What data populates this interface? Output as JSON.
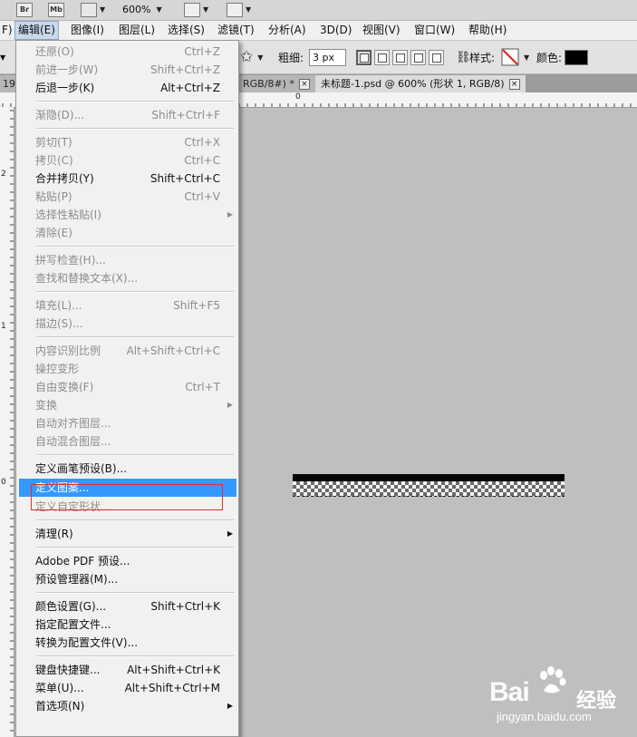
{
  "appbar": {
    "bridge_label": "Br",
    "minibridge_label": "Mb",
    "zoom": "600%"
  },
  "menubar": {
    "items": [
      "F)",
      "编辑(E)",
      "图像(I)",
      "图层(L)",
      "选择(S)",
      "滤镜(T)",
      "分析(A)",
      "3D(D)",
      "视图(V)",
      "窗口(W)",
      "帮助(H)"
    ]
  },
  "options": {
    "weight_label": "粗细:",
    "weight_value": "3 px",
    "style_label": "样式:",
    "color_label": "颜色:",
    "color_value": "#000000"
  },
  "tabs": {
    "left_fragment": "19",
    "doc1": "RGB/8#) *",
    "doc2": "未标题-1.psd @ 600% (形状 1, RGB/8)",
    "close_glyph": "×"
  },
  "rulers": {
    "h_zero": "0",
    "v_labels": [
      "2",
      "1",
      "0"
    ]
  },
  "menu": {
    "items": [
      {
        "label": "还原(O)",
        "shortcut": "Ctrl+Z",
        "enabled": false
      },
      {
        "label": "前进一步(W)",
        "shortcut": "Shift+Ctrl+Z",
        "enabled": false
      },
      {
        "label": "后退一步(K)",
        "shortcut": "Alt+Ctrl+Z",
        "enabled": true
      },
      {
        "label": "渐隐(D)...",
        "shortcut": "Shift+Ctrl+F",
        "enabled": false
      },
      {
        "label": "剪切(T)",
        "shortcut": "Ctrl+X",
        "enabled": false
      },
      {
        "label": "拷贝(C)",
        "shortcut": "Ctrl+C",
        "enabled": false
      },
      {
        "label": "合并拷贝(Y)",
        "shortcut": "Shift+Ctrl+C",
        "enabled": true
      },
      {
        "label": "粘贴(P)",
        "shortcut": "Ctrl+V",
        "enabled": false
      },
      {
        "label": "选择性粘贴(I)",
        "shortcut": "",
        "enabled": false,
        "submenu": true
      },
      {
        "label": "清除(E)",
        "shortcut": "",
        "enabled": false
      },
      {
        "label": "拼写检查(H)...",
        "shortcut": "",
        "enabled": false
      },
      {
        "label": "查找和替换文本(X)...",
        "shortcut": "",
        "enabled": false
      },
      {
        "label": "填充(L)...",
        "shortcut": "Shift+F5",
        "enabled": false
      },
      {
        "label": "描边(S)...",
        "shortcut": "",
        "enabled": false
      },
      {
        "label": "内容识别比例",
        "shortcut": "Alt+Shift+Ctrl+C",
        "enabled": false
      },
      {
        "label": "操控变形",
        "shortcut": "",
        "enabled": false
      },
      {
        "label": "自由变换(F)",
        "shortcut": "Ctrl+T",
        "enabled": false
      },
      {
        "label": "变换",
        "shortcut": "",
        "enabled": false,
        "submenu": true
      },
      {
        "label": "自动对齐图层...",
        "shortcut": "",
        "enabled": false
      },
      {
        "label": "自动混合图层...",
        "shortcut": "",
        "enabled": false
      },
      {
        "label": "定义画笔预设(B)...",
        "shortcut": "",
        "enabled": true
      },
      {
        "label": "定义图案...",
        "shortcut": "",
        "enabled": true,
        "highlighted": true
      },
      {
        "label": "定义自定形状...",
        "shortcut": "",
        "enabled": false
      },
      {
        "label": "清理(R)",
        "shortcut": "",
        "enabled": true,
        "submenu": true
      },
      {
        "label": "Adobe PDF 预设...",
        "shortcut": "",
        "enabled": true
      },
      {
        "label": "预设管理器(M)...",
        "shortcut": "",
        "enabled": true
      },
      {
        "label": "颜色设置(G)...",
        "shortcut": "Shift+Ctrl+K",
        "enabled": true
      },
      {
        "label": "指定配置文件...",
        "shortcut": "",
        "enabled": true
      },
      {
        "label": "转换为配置文件(V)...",
        "shortcut": "",
        "enabled": true
      },
      {
        "label": "键盘快捷键...",
        "shortcut": "Alt+Shift+Ctrl+K",
        "enabled": true
      },
      {
        "label": "菜单(U)...",
        "shortcut": "Alt+Shift+Ctrl+M",
        "enabled": true
      },
      {
        "label": "首选项(N)",
        "shortcut": "",
        "enabled": true,
        "submenu": true
      }
    ]
  },
  "watermark": {
    "brand": "Bai",
    "brand_suffix": "经验",
    "url": "jingyan.baidu.com"
  },
  "colors": {
    "highlight": "#3399ff",
    "canvas": "#bfbfbf",
    "annotation": "#e03030"
  }
}
